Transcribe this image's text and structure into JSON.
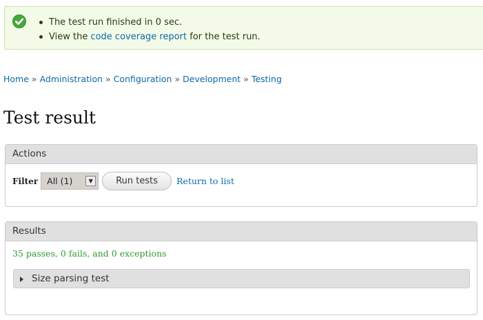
{
  "status": {
    "messages": [
      {
        "text": "The test run finished in 0 sec."
      },
      {
        "prefix": "View the ",
        "link": "code coverage report",
        "suffix": " for the test run."
      }
    ],
    "icon": "check-circle-icon",
    "color": "#49a53c"
  },
  "breadcrumb": {
    "items": [
      "Home",
      "Administration",
      "Configuration",
      "Development",
      "Testing"
    ],
    "separator": "»"
  },
  "page": {
    "title": "Test result"
  },
  "actions": {
    "title": "Actions",
    "filter_label": "Filter",
    "filter_value": "All (1)",
    "run_button": "Run tests",
    "return_link": "Return to list"
  },
  "results": {
    "title": "Results",
    "summary": "35 passes, 0 fails, and 0 exceptions",
    "summary_color": "#2e9a2e",
    "groups": [
      {
        "label": "Size parsing test",
        "expanded": false
      }
    ]
  }
}
